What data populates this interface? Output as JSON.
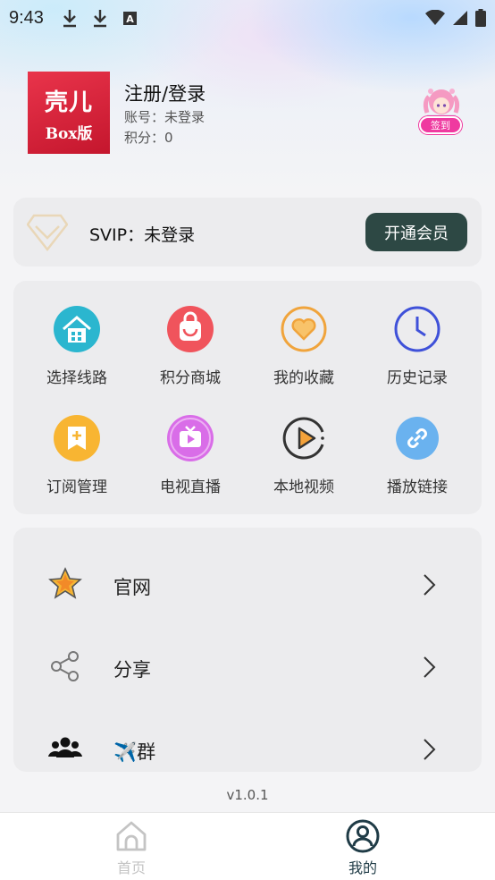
{
  "status_bar": {
    "time": "9:43",
    "icons": [
      "download-icon",
      "download-icon",
      "a-box-icon"
    ],
    "right_icons": [
      "wifi-icon",
      "signal-icon",
      "battery-icon"
    ]
  },
  "profile": {
    "logo_line1": "壳儿",
    "logo_line2": "Box版",
    "title": "注册/登录",
    "account": "账号：未登录",
    "points": "积分：0",
    "signin_label": "签到"
  },
  "svip": {
    "text": "SVIP：未登录",
    "button": "开通会员"
  },
  "grid": [
    {
      "label": "选择线路",
      "icon": "house-icon",
      "color": "#2bb6cf"
    },
    {
      "label": "积分商城",
      "icon": "shopping-bag-icon",
      "color": "#f0545c"
    },
    {
      "label": "我的收藏",
      "icon": "heart-icon",
      "color": "#f0a43c"
    },
    {
      "label": "历史记录",
      "icon": "clock-icon",
      "color": "#3f51d9"
    },
    {
      "label": "订阅管理",
      "icon": "bookmark-plus-icon",
      "color": "#f8b532"
    },
    {
      "label": "电视直播",
      "icon": "tv-icon",
      "color": "#d96de8"
    },
    {
      "label": "本地视频",
      "icon": "play-circle-icon",
      "color": "#333333"
    },
    {
      "label": "播放链接",
      "icon": "link-icon",
      "color": "#6ab2ef"
    }
  ],
  "menu": [
    {
      "label": "官网",
      "icon": "star-icon"
    },
    {
      "label": "分享",
      "icon": "share-icon"
    },
    {
      "label": "✈️群",
      "icon": "group-icon"
    }
  ],
  "version": "v1.0.1",
  "tabs": [
    {
      "label": "首页",
      "icon": "home-icon",
      "active": false
    },
    {
      "label": "我的",
      "icon": "user-icon",
      "active": true
    }
  ],
  "colors": {
    "accent": "#2d4844",
    "signin": "#ef3aa0",
    "logo": "#d8203a"
  }
}
